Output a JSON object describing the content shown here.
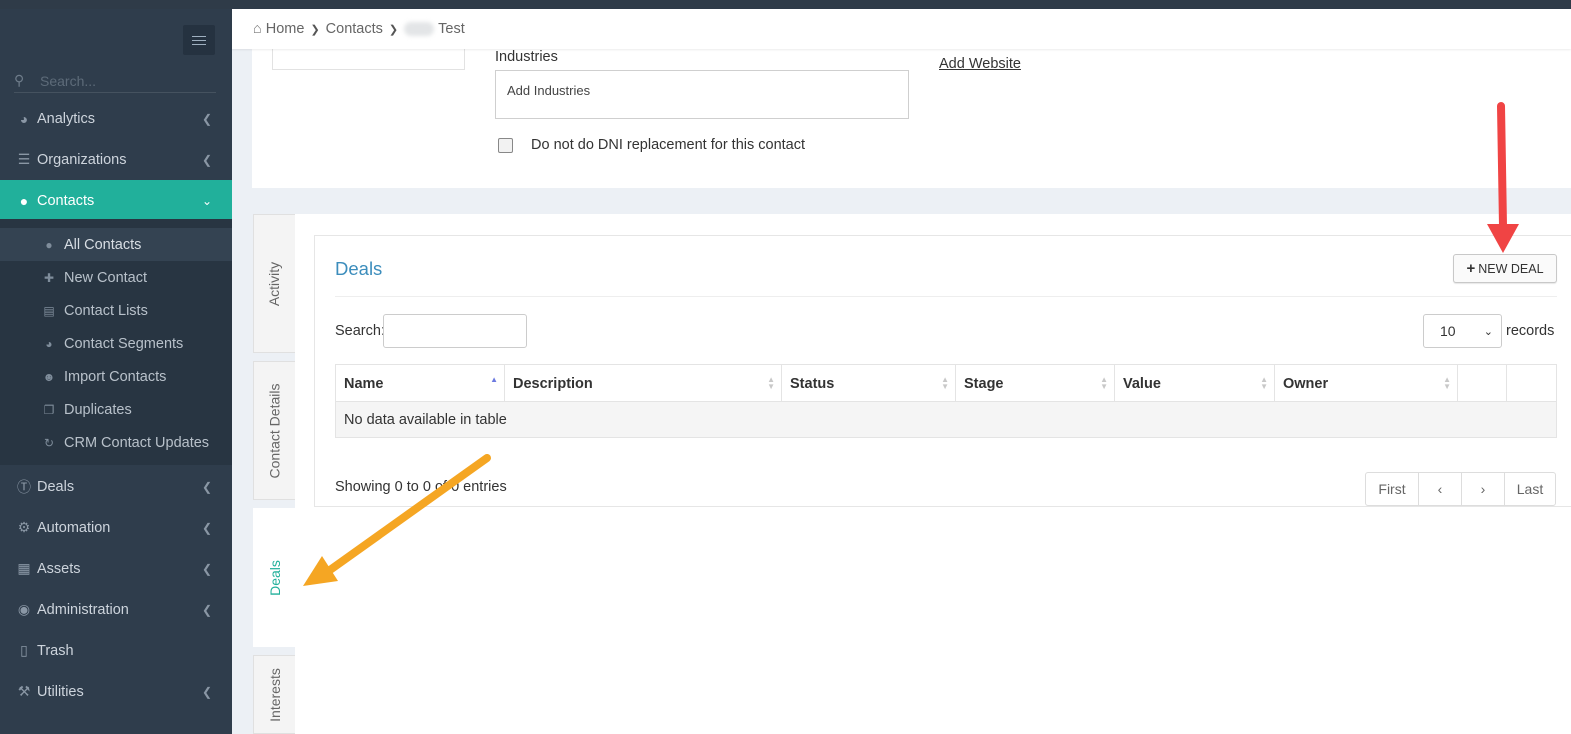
{
  "sidebar": {
    "search_placeholder": "Search...",
    "items": [
      {
        "label": "Analytics"
      },
      {
        "label": "Organizations"
      },
      {
        "label": "Contacts"
      },
      {
        "label": "Deals"
      },
      {
        "label": "Automation"
      },
      {
        "label": "Assets"
      },
      {
        "label": "Administration"
      },
      {
        "label": "Trash"
      },
      {
        "label": "Utilities"
      }
    ],
    "contacts_sub": [
      {
        "label": "All Contacts"
      },
      {
        "label": "New Contact"
      },
      {
        "label": "Contact Lists"
      },
      {
        "label": "Contact Segments"
      },
      {
        "label": "Import Contacts"
      },
      {
        "label": "Duplicates"
      },
      {
        "label": "CRM Contact Updates"
      }
    ]
  },
  "breadcrumb": {
    "home": "Home",
    "contacts": "Contacts",
    "current": "Test"
  },
  "contact_form": {
    "industries_label": "Industries",
    "industries_placeholder": "Add Industries",
    "add_website": "Add Website",
    "dni_label": "Do not do DNI replacement for this contact"
  },
  "vertical_tabs": {
    "activity": "Activity",
    "details": "Contact Details",
    "deals": "Deals",
    "interests": "Interests"
  },
  "deals": {
    "title": "Deals",
    "new_deal_label": "NEW DEAL",
    "search_label": "Search:",
    "page_length": "10",
    "records_label": "records",
    "columns": [
      "Name",
      "Description",
      "Status",
      "Stage",
      "Value",
      "Owner",
      "",
      ""
    ],
    "empty_text": "No data available in table",
    "showing": "Showing 0 to 0 of 0 entries",
    "pager": {
      "first": "First",
      "prev": "‹",
      "next": "›",
      "last": "Last"
    }
  },
  "colors": {
    "accent": "#21b09b",
    "sidebar": "#2f3d4c",
    "link": "#3c8dbc",
    "arrow_red": "#f04444",
    "arrow_orange": "#f5a623"
  }
}
